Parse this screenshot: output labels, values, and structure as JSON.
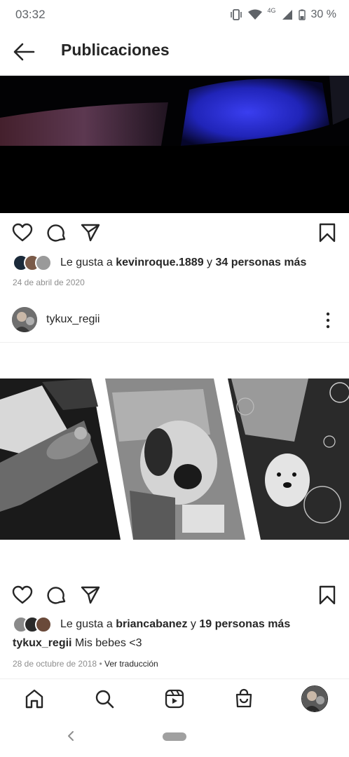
{
  "status_bar": {
    "time": "03:32",
    "network": "4G",
    "battery": "30 %"
  },
  "header": {
    "title": "Publicaciones"
  },
  "post1": {
    "likes_prefix": "Le gusta a",
    "liker": "kevinroque.1889",
    "likes_joiner": "y",
    "others": "34 personas más",
    "date": "24 de abril de 2020"
  },
  "post2": {
    "username": "tykux_regii",
    "likes_prefix": "Le gusta a",
    "liker": "briancabanez",
    "likes_joiner": "y",
    "others": "19 personas más",
    "caption_user": "tykux_regii",
    "caption_text": "Mis bebes <3",
    "date": "28 de octubre de 2018",
    "separator": "•",
    "translate": "Ver traducción"
  },
  "icons": {
    "like": "heart-icon",
    "comment": "comment-icon",
    "share": "send-icon",
    "save": "bookmark-icon",
    "more": "more-vertical-icon",
    "home": "home-icon",
    "search": "search-icon",
    "reels": "reels-icon",
    "shop": "shop-icon"
  }
}
